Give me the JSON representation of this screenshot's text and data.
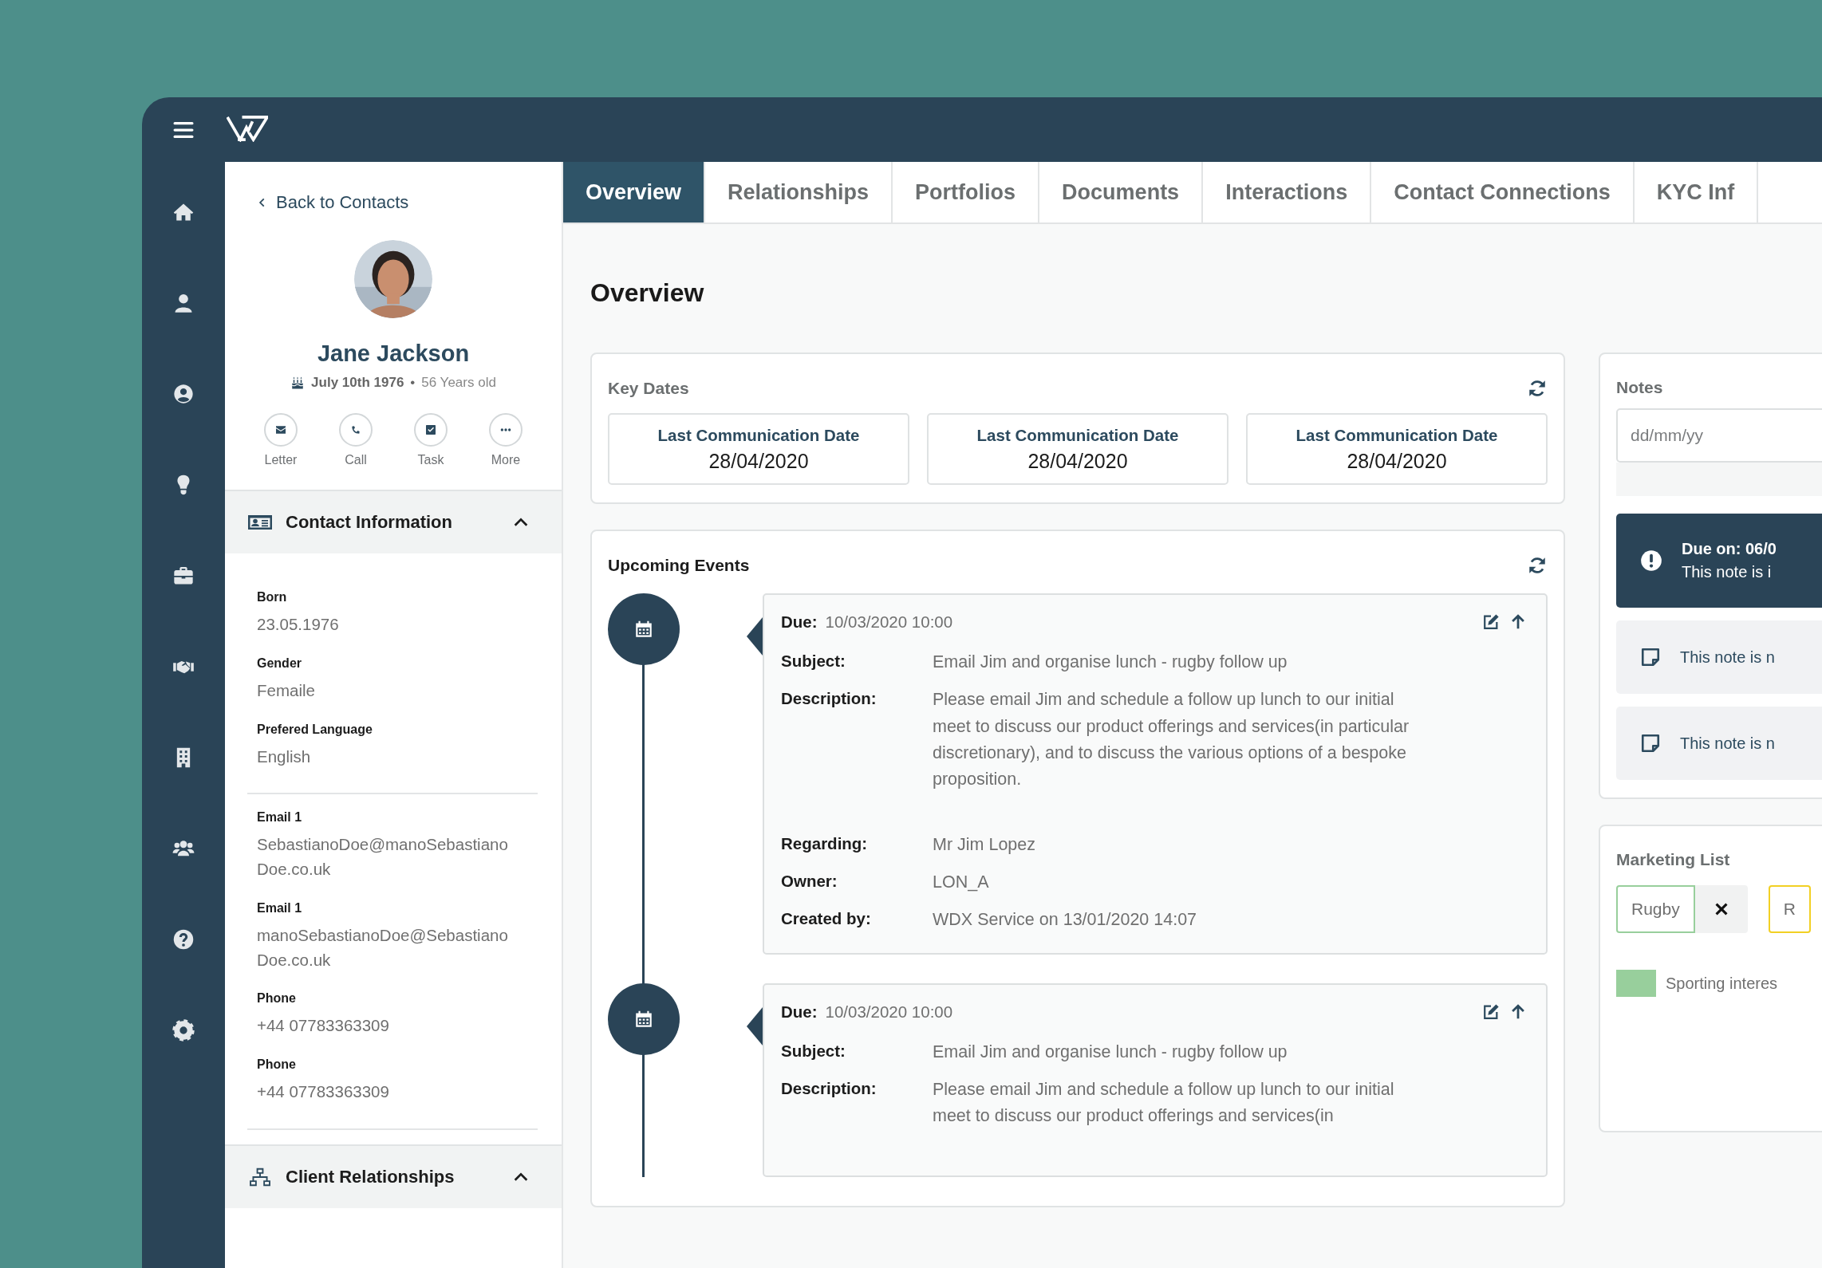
{
  "contact": {
    "back_link": "Back to Contacts",
    "name": "Jane Jackson",
    "birth_date": "July 10th 1976",
    "separator": "•",
    "age": "56 Years old",
    "actions": [
      {
        "label": "Letter",
        "kind": "letter"
      },
      {
        "label": "Call",
        "kind": "call"
      },
      {
        "label": "Task",
        "kind": "task"
      },
      {
        "label": "More",
        "kind": "more"
      }
    ],
    "sections": [
      {
        "title": "Contact Information",
        "kind": "card",
        "expanded": true,
        "groups": [
          [
            {
              "label": "Born",
              "value": "23.05.1976"
            },
            {
              "label": "Gender",
              "value": "Femaile"
            },
            {
              "label": "Prefered Language",
              "value": "English"
            }
          ],
          [
            {
              "label": "Email 1",
              "value": "SebastianoDoe@manoSebastianoDoe.co.uk"
            },
            {
              "label": "Email 1",
              "value": "manoSebastianoDoe@SebastianoDoe.co.uk"
            },
            {
              "label": "Phone",
              "value": "+44 07783363309"
            },
            {
              "label": "Phone",
              "value": "+44 07783363309"
            }
          ]
        ]
      },
      {
        "title": "Client Relationships",
        "kind": "network",
        "expanded": true
      }
    ]
  },
  "tabs": [
    {
      "label": "Overview",
      "selected": true
    },
    {
      "label": "Relationships",
      "selected": false
    },
    {
      "label": "Portfolios",
      "selected": false
    },
    {
      "label": "Documents",
      "selected": false
    },
    {
      "label": "Interactions",
      "selected": false
    },
    {
      "label": "Contact Connections",
      "selected": false
    },
    {
      "label": "KYC Inf",
      "selected": false
    }
  ],
  "page_title": "Overview",
  "key_dates": {
    "title": "Key Dates",
    "dates": [
      {
        "label": "Last Communication Date",
        "value": "28/04/2020"
      },
      {
        "label": "Last Communication Date",
        "value": "28/04/2020"
      },
      {
        "label": "Last Communication Date",
        "value": "28/04/2020"
      }
    ]
  },
  "upcoming_events": {
    "title": "Upcoming Events",
    "events": [
      {
        "due_label": "Due:",
        "due": "10/03/2020 10:00",
        "details": [
          {
            "label": "Subject:",
            "value": "Email Jim and organise lunch - rugby follow up"
          },
          {
            "label": "Description:",
            "value": "Please email Jim and schedule a follow up lunch to our initial meet to discuss our product offerings and services(in particular discretionary), and to discuss the various options of a bespoke proposition."
          },
          {
            "label": "Regarding:",
            "value": "Mr Jim Lopez"
          },
          {
            "label": "Owner:",
            "value": "LON_A"
          },
          {
            "label": "Created by:",
            "value": "WDX Service on 13/01/2020 14:07"
          }
        ]
      },
      {
        "due_label": "Due:",
        "due": "10/03/2020 10:00",
        "details": [
          {
            "label": "Subject:",
            "value": "Email Jim and organise lunch - rugby follow up"
          },
          {
            "label": "Description:",
            "value": "Please email Jim and schedule a follow up lunch to our initial meet to discuss our product offerings and services(in"
          }
        ]
      }
    ]
  },
  "notes": {
    "title": "Notes",
    "date_placeholder": "dd/mm/yy",
    "items": [
      {
        "kind": "important",
        "title": "Due on: 06/0",
        "text": "This note is i"
      },
      {
        "kind": "normal",
        "text": "This note is n"
      },
      {
        "kind": "normal",
        "text": "This note is n"
      }
    ]
  },
  "marketing_list": {
    "title": "Marketing List",
    "tags": [
      {
        "label": "Rugby",
        "color": "#98cf9c",
        "removable": true
      },
      {
        "label": "R",
        "color": "#f2d024",
        "removable": false
      }
    ],
    "legend": [
      {
        "label": "Sporting interes",
        "color": "#98cf9c"
      }
    ]
  }
}
